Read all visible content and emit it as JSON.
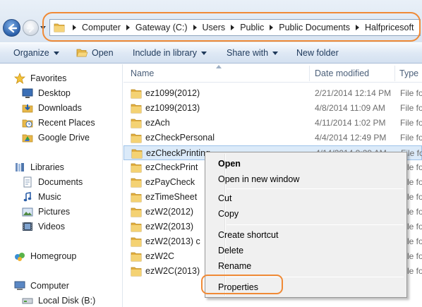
{
  "address_bar": {
    "crumbs": [
      "Computer",
      "Gateway (C:)",
      "Users",
      "Public",
      "Public Documents",
      "Halfpricesoft"
    ],
    "highlight_color": "#f08a36"
  },
  "toolbar": {
    "organize": "Organize",
    "open": "Open",
    "include_in_library": "Include in library",
    "share_with": "Share with",
    "new_folder": "New folder"
  },
  "nav": {
    "favorites": {
      "label": "Favorites",
      "items": [
        {
          "label": "Desktop",
          "icon": "desktop-icon"
        },
        {
          "label": "Downloads",
          "icon": "downloads-icon"
        },
        {
          "label": "Recent Places",
          "icon": "recent-places-icon"
        },
        {
          "label": "Google Drive",
          "icon": "google-drive-icon"
        }
      ]
    },
    "libraries": {
      "label": "Libraries",
      "items": [
        {
          "label": "Documents",
          "icon": "documents-icon"
        },
        {
          "label": "Music",
          "icon": "music-icon"
        },
        {
          "label": "Pictures",
          "icon": "pictures-icon"
        },
        {
          "label": "Videos",
          "icon": "videos-icon"
        }
      ]
    },
    "homegroup": "Homegroup",
    "computer": "Computer",
    "local_disk": "Local Disk (B:)"
  },
  "columns": {
    "name": "Name",
    "date_modified": "Date modified",
    "type": "Type"
  },
  "files": [
    {
      "name": "ez1099(2012)",
      "date": "2/21/2014 12:14 PM",
      "type": "File fo"
    },
    {
      "name": "ez1099(2013)",
      "date": "4/8/2014 11:09 AM",
      "type": "File fo"
    },
    {
      "name": "ezAch",
      "date": "4/11/2014 1:02 PM",
      "type": "File fo"
    },
    {
      "name": "ezCheckPersonal",
      "date": "4/4/2014 12:49 PM",
      "type": "File fo"
    },
    {
      "name": "ezCheckPrinting",
      "date": "4/14/2014 9:29 AM",
      "type": "File fo"
    },
    {
      "name": "ezCheckPrint",
      "date": "",
      "type": "File fo"
    },
    {
      "name": "ezPayCheck",
      "date": "",
      "type": "File fo"
    },
    {
      "name": "ezTimeSheet",
      "date": "",
      "type": "File fo"
    },
    {
      "name": "ezW2(2012)",
      "date": "",
      "type": "File fo"
    },
    {
      "name": "ezW2(2013)",
      "date": "",
      "type": "File fo"
    },
    {
      "name": "ezW2(2013) c",
      "date": "",
      "type": "File fo"
    },
    {
      "name": "ezW2C",
      "date": "",
      "type": "File fo"
    },
    {
      "name": "ezW2C(2013)",
      "date": "",
      "type": "File fo"
    }
  ],
  "context_menu": {
    "open": "Open",
    "open_new_window": "Open in new window",
    "cut": "Cut",
    "copy": "Copy",
    "create_shortcut": "Create shortcut",
    "delete": "Delete",
    "rename": "Rename",
    "properties": "Properties"
  }
}
